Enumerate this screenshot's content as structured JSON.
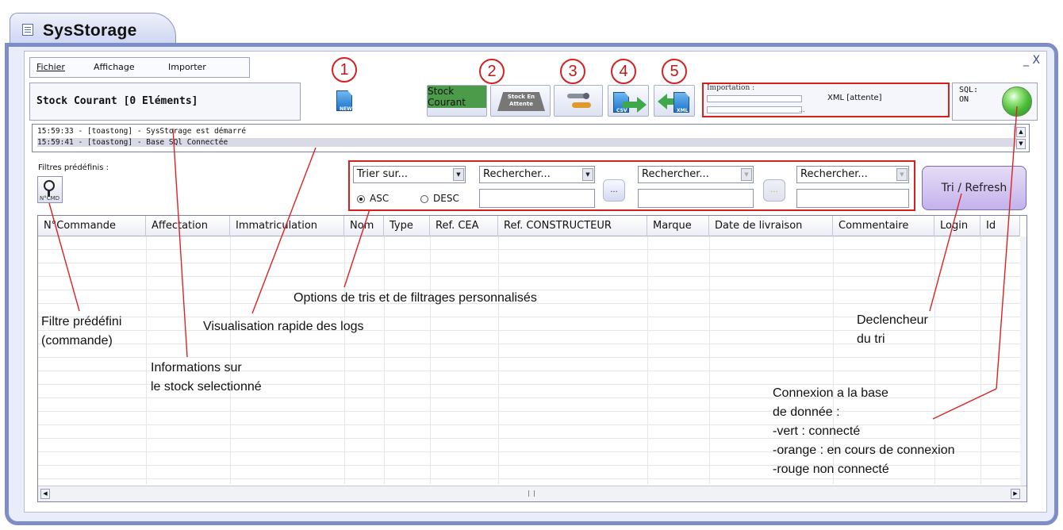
{
  "window": {
    "title": "SysStorage",
    "controls": "_ X"
  },
  "menu": {
    "items": [
      "Fichier",
      "Affichage",
      "Importer"
    ]
  },
  "stock": {
    "title": "Stock Courant [0 Eléments]"
  },
  "toolbar": {
    "new_label": "NEW",
    "stock_courant_label": "Stock Courant",
    "stock_attente_label": "Stock En Attente",
    "csv_label": "CSV",
    "xml_label": "XML",
    "callouts": [
      "1",
      "2",
      "3",
      "4",
      "5"
    ]
  },
  "import": {
    "title": "Importation :",
    "status": "XML [attente]",
    "dots": "..."
  },
  "sql": {
    "label": "SQL:",
    "state": "ON",
    "led_color": "#4cbc3a"
  },
  "logs": [
    "15:59:33 - [toastong] - SysStorage est démarré",
    "15:59:41 - [toastong] - Base SQl Connectée"
  ],
  "filters": {
    "label": "Filtres prédéfinis :",
    "button_label": "N°CMD"
  },
  "sort": {
    "sort_select": "Trier sur...",
    "search_selects": [
      "Rechercher...",
      "Rechercher...",
      "Rechercher..."
    ],
    "asc_label": "ASC",
    "desc_label": "DESC",
    "selected_order": "ASC",
    "dots": "..."
  },
  "refresh_button": "Tri / Refresh",
  "table": {
    "columns": [
      "N°Commande",
      "Affectation",
      "Immatriculation",
      "Nom",
      "Type",
      "Ref. CEA",
      "Ref. CONSTRUCTEUR",
      "Marque",
      "Date de livraison",
      "Commentaire",
      "Login",
      "Id"
    ],
    "rows": []
  },
  "annotations": {
    "filter": [
      "Filtre prédéfini",
      "(commande)"
    ],
    "logs": "Visualisation rapide des logs",
    "stock_info": [
      "Informations sur",
      "le stock selectionné"
    ],
    "sort_options": "Options de tris et de filtrages personnalisés",
    "trigger": [
      "Declencheur",
      "du tri"
    ],
    "connection": [
      "Connexion a la base",
      "de donnée :",
      "-vert : connecté",
      "-orange : en cours de connexion",
      "-rouge non connecté"
    ]
  }
}
